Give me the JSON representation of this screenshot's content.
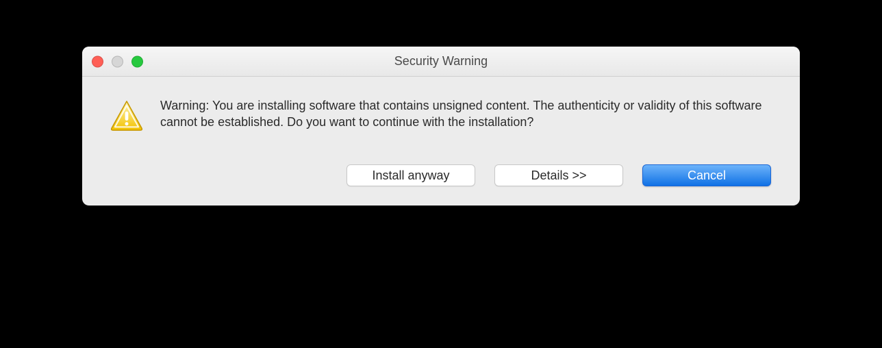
{
  "dialog": {
    "title": "Security Warning",
    "message": "Warning: You are installing software that contains unsigned content. The authenticity or validity of this software cannot be established. Do you want to continue with the installation?",
    "buttons": {
      "install": "Install anyway",
      "details": "Details >>",
      "cancel": "Cancel"
    }
  }
}
